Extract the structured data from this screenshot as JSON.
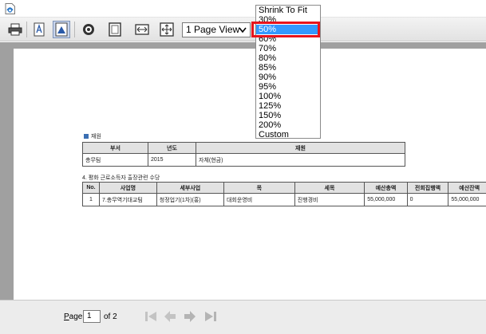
{
  "toolbar": {
    "view_mode": "1 Page View"
  },
  "zoom_dropdown": {
    "options": [
      "Shrink To Fit",
      "30%",
      "50%",
      "60%",
      "70%",
      "80%",
      "85%",
      "90%",
      "95%",
      "100%",
      "125%",
      "150%",
      "200%",
      "Custom"
    ],
    "selected": "50%"
  },
  "document": {
    "section1": {
      "title": "재원",
      "headers": [
        "부서",
        "년도",
        "재원"
      ],
      "row": [
        "총무팀",
        "2015",
        "자체(현금)"
      ]
    },
    "section2": {
      "title": "4. 평화 근로소득자 출장관련 수당",
      "headers": [
        "No.",
        "사업명",
        "세부사업",
        "목",
        "세목",
        "예산총액",
        "전회집행액",
        "예산잔액"
      ],
      "row": [
        "1",
        "7.총무역기대교팀",
        "청정업기(1차)(홍)",
        "대회운영비",
        "진행경비",
        "55,000,000",
        "0",
        "55,000,000"
      ]
    }
  },
  "pager": {
    "label_prefix": "P",
    "label_rest": "age",
    "current_page": "1",
    "of_text": "of 2"
  },
  "colors": {
    "highlight": "#e8141c",
    "selection": "#3399ff"
  }
}
